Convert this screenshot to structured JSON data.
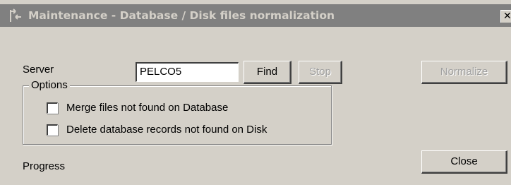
{
  "window": {
    "title": "Maintenance - Database / Disk files normalization",
    "close_glyph": "✕",
    "title_icon": "maintenance-icon"
  },
  "server": {
    "label": "Server",
    "value": "PELCO5"
  },
  "buttons": {
    "find": "Find",
    "stop": "Stop",
    "normalize": "Normalize",
    "close": "Close"
  },
  "options": {
    "legend": "Options",
    "items": [
      {
        "label": "Merge files not found on Database",
        "checked": false
      },
      {
        "label": "Delete database records not found on Disk",
        "checked": false
      }
    ]
  },
  "progress": {
    "label": "Progress"
  },
  "colors": {
    "face": "#d4d0c8",
    "title_bar_inactive": "#808080",
    "disabled_text": "#a0a0a0"
  }
}
